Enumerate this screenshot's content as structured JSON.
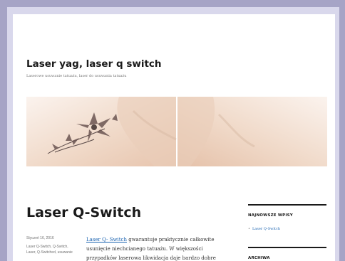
{
  "site": {
    "title": "Laser yag, laser q switch",
    "description": "Laserowe usuwanie tatuażu, laser do usuwania tatuażu"
  },
  "header_image": {
    "alt": "tattoo-removal-before-after"
  },
  "post": {
    "title": "Laser Q-Switch",
    "date": "Styczeń 16, 2016",
    "tags": "Laser Q-Switch, Q-Switch, Laser, Q-Switched, usuwanie",
    "link_text": "Laser Q- Switch",
    "body_line1": " gwarantuje praktycznie całkowite",
    "body_line2": "usunięcie niechcianego tatuażu. W większości",
    "body_line3": "przypadków laserowa likwidacja daje bardzo dobre"
  },
  "sidebar": {
    "recent_title": "NAJNOWSZE WPISY",
    "recent_items": [
      "Laser Q-Switch"
    ],
    "archive_title": "ARCHIWA"
  },
  "colors": {
    "link": "#1a63b0",
    "frame": "#a6a4c6"
  }
}
